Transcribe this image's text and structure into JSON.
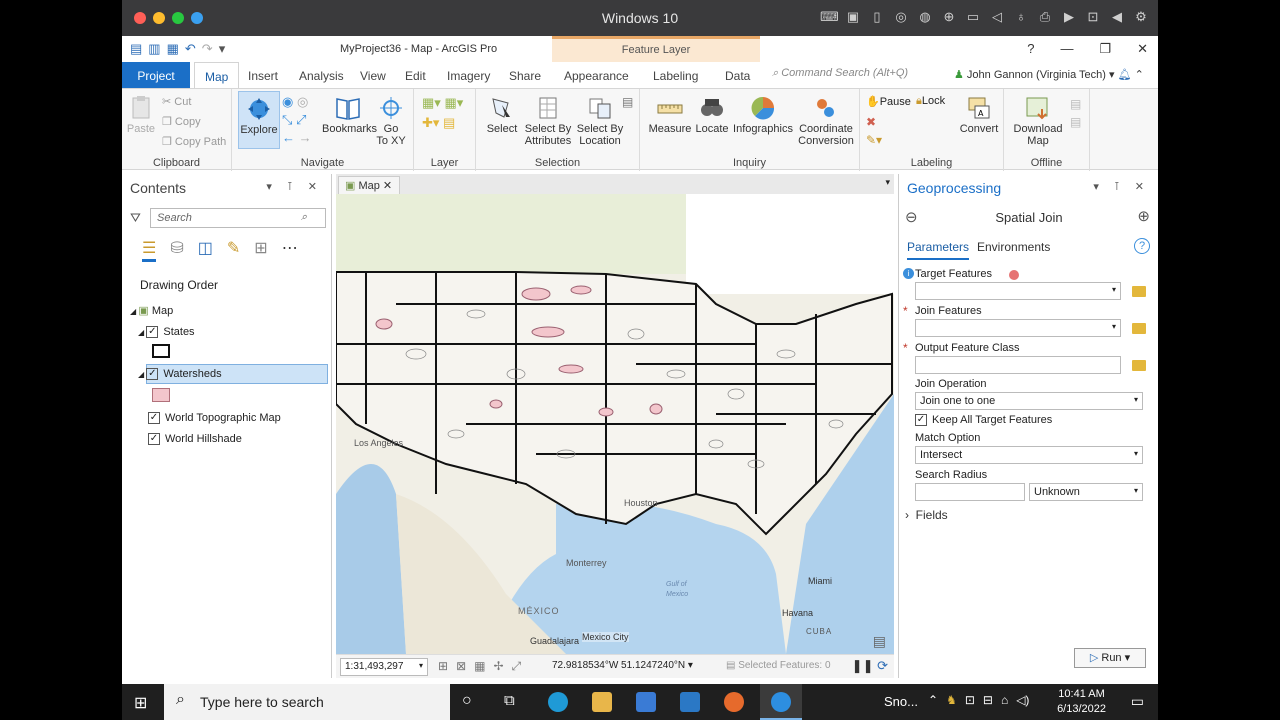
{
  "mac": {
    "title": "Windows 10"
  },
  "app": {
    "window_title": "MyProject36 - Map - ArcGIS Pro",
    "context_tab": "Feature Layer",
    "tabs": [
      "Project",
      "Map",
      "Insert",
      "Analysis",
      "View",
      "Edit",
      "Imagery",
      "Share",
      "Appearance",
      "Labeling",
      "Data"
    ],
    "command_search": "Command Search (Alt+Q)",
    "user": "John Gannon (Virginia Tech)",
    "help": "?"
  },
  "ribbon": {
    "clipboard": {
      "label": "Clipboard",
      "paste": "Paste",
      "cut": "Cut",
      "copy": "Copy",
      "copy_path": "Copy Path"
    },
    "navigate": {
      "label": "Navigate",
      "explore": "Explore",
      "bookmarks": "Bookmarks",
      "go": "Go",
      "to_xy": "To XY"
    },
    "layer": {
      "label": "Layer"
    },
    "selection": {
      "label": "Selection",
      "select": "Select",
      "by_attr1": "Select By",
      "by_attr2": "Attributes",
      "by_loc1": "Select By",
      "by_loc2": "Location"
    },
    "inquiry": {
      "label": "Inquiry",
      "measure": "Measure",
      "locate": "Locate",
      "infographics": "Infographics",
      "coord1": "Coordinate",
      "coord2": "Conversion"
    },
    "labeling": {
      "label": "Labeling",
      "pause": "Pause",
      "lock": "Lock",
      "convert": "Convert"
    },
    "offline": {
      "label": "Offline",
      "download1": "Download",
      "download2": "Map"
    }
  },
  "contents": {
    "title": "Contents",
    "search_placeholder": "Search",
    "drawing_order": "Drawing Order",
    "layers": {
      "map": "Map",
      "states": "States",
      "watersheds": "Watersheds",
      "topo": "World Topographic Map",
      "hillshade": "World Hillshade"
    }
  },
  "map": {
    "tab": "Map",
    "scale": "1:31,493,297",
    "coords": "72.9818534°W 51.1247240°N",
    "selected": "Selected Features: 0",
    "labels": {
      "la": "Los Angeles",
      "houston": "Houston",
      "miami": "Miami",
      "havana": "Havana",
      "monterrey": "Monterrey",
      "mexico": "MÉXICO",
      "guadalajara": "Guadalajara",
      "mexico_city": "Mexico City",
      "cuba": "CUBA",
      "gulf1": "Gulf of",
      "gulf2": "Mexico"
    }
  },
  "geoprocessing": {
    "title": "Geoprocessing",
    "tool": "Spatial Join",
    "tab_params": "Parameters",
    "tab_env": "Environments",
    "target": "Target Features",
    "join": "Join Features",
    "output": "Output Feature Class",
    "join_op": "Join Operation",
    "join_op_val": "Join one to one",
    "keep_all": "Keep All Target Features",
    "match": "Match Option",
    "match_val": "Intersect",
    "radius": "Search Radius",
    "radius_unit": "Unknown",
    "fields": "Fields",
    "run": "Run"
  },
  "taskbar": {
    "search": "Type here to search",
    "sno": "Sno...",
    "time": "10:41 AM",
    "date": "6/13/2022"
  },
  "colors": {
    "accent": "#1b6fc7",
    "context": "#fbe8d2",
    "watershed": "#f3c6cc"
  }
}
